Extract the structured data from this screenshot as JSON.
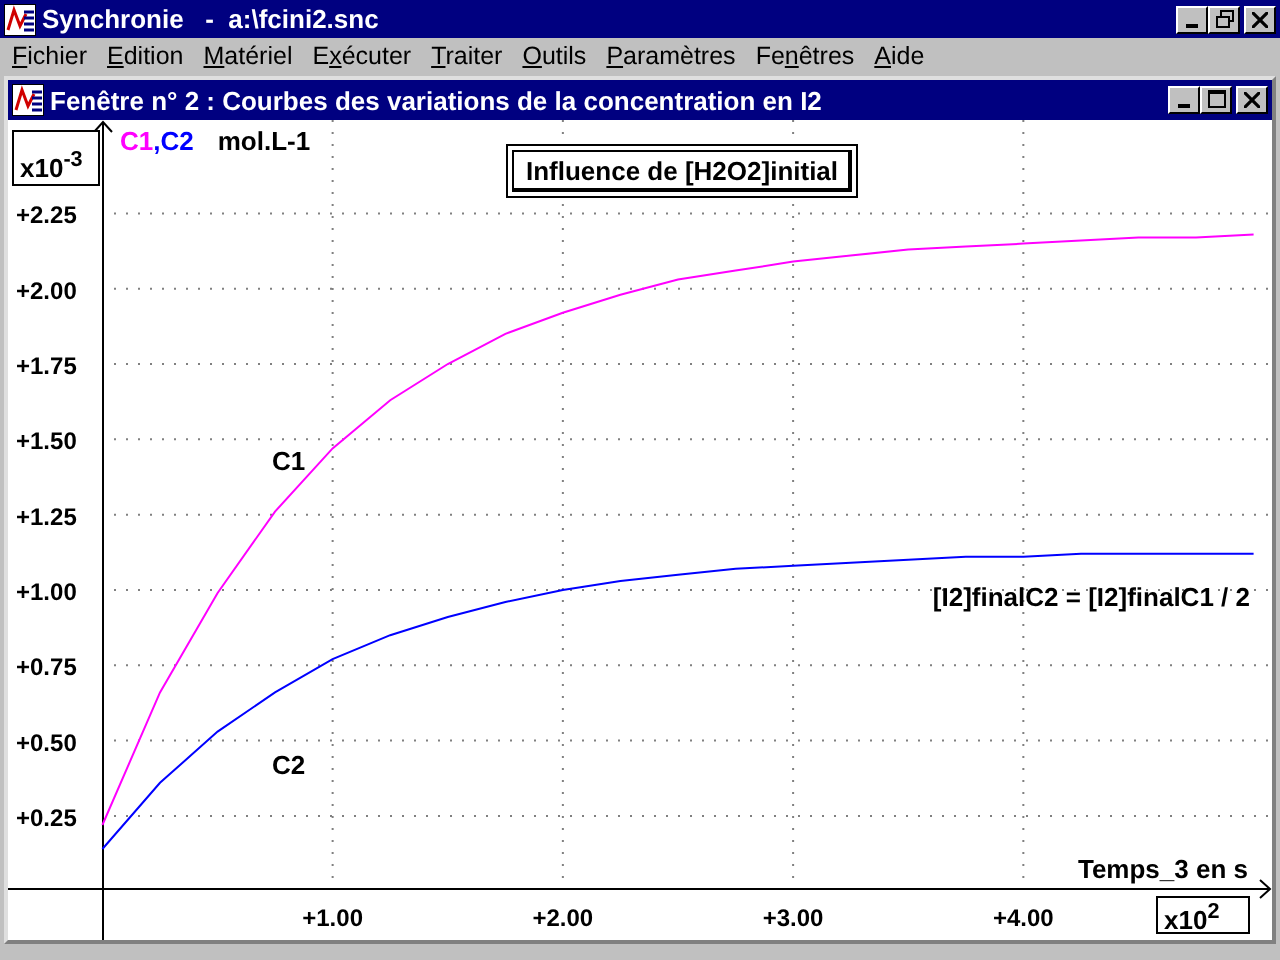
{
  "window": {
    "title": "Synchronie   -  a:\\fcini2.snc"
  },
  "menu": [
    {
      "key": "F",
      "after": "ichier"
    },
    {
      "key": "E",
      "after": "dition"
    },
    {
      "key": "M",
      "after": "atériel"
    },
    {
      "before": "E",
      "key": "x",
      "after": "écuter"
    },
    {
      "key": "T",
      "after": "raiter"
    },
    {
      "key": "O",
      "after": "utils"
    },
    {
      "key": "P",
      "after": "aramètres"
    },
    {
      "before": "Fe",
      "key": "n",
      "after": "êtres"
    },
    {
      "key": "A",
      "after": "ide"
    }
  ],
  "child_window": {
    "title": "Fenêtre n° 2 : Courbes des variations de la concentration en I2",
    "y_multiplier": "x10$^{-3}$",
    "x_multiplier": "x10$^{2}$",
    "legend_separator": ",",
    "chart_data": {
      "type": "line",
      "title": "Influence de [H2O2]initial",
      "xlabel": "Temps_3 en s",
      "ylabel": "mol.L-1",
      "grid": true,
      "x": [
        0,
        0.25,
        0.5,
        0.75,
        1,
        1.25,
        1.5,
        1.75,
        2,
        2.25,
        2.5,
        2.75,
        3,
        3.25,
        3.5,
        3.75,
        4,
        4.25,
        4.5,
        4.75,
        5
      ],
      "series": [
        {
          "name": "C1",
          "color": "#ff00ff",
          "values": [
            0.22,
            0.66,
            0.99,
            1.26,
            1.47,
            1.63,
            1.75,
            1.85,
            1.92,
            1.98,
            2.03,
            2.06,
            2.09,
            2.11,
            2.13,
            2.14,
            2.15,
            2.16,
            2.17,
            2.17,
            2.18
          ]
        },
        {
          "name": "C2",
          "color": "#0000ff",
          "values": [
            0.14,
            0.36,
            0.53,
            0.66,
            0.77,
            0.85,
            0.91,
            0.96,
            1.0,
            1.03,
            1.05,
            1.07,
            1.08,
            1.09,
            1.1,
            1.11,
            1.11,
            1.12,
            1.12,
            1.12,
            1.12
          ]
        }
      ],
      "xlim": [
        -0.41,
        5.08
      ],
      "ylim": [
        0,
        2.56
      ],
      "xticks": [
        {
          "value": 1,
          "label": "+1.00"
        },
        {
          "value": 2,
          "label": "+2.00"
        },
        {
          "value": 3,
          "label": "+3.00"
        },
        {
          "value": 4,
          "label": "+4.00"
        }
      ],
      "yticks": [
        {
          "value": 0.25,
          "label": "+0.25"
        },
        {
          "value": 0.5,
          "label": "+0.50"
        },
        {
          "value": 0.75,
          "label": "+0.75"
        },
        {
          "value": 1,
          "label": "+1.00"
        },
        {
          "value": 1.25,
          "label": "+1.25"
        },
        {
          "value": 1.5,
          "label": "+1.50"
        },
        {
          "value": 1.75,
          "label": "+1.75"
        },
        {
          "value": 2,
          "label": "+2.00"
        },
        {
          "value": 2.25,
          "label": "+2.25"
        }
      ],
      "annotations": [
        {
          "text": "C1"
        },
        {
          "text": "C2"
        },
        {
          "text": "[I2]finalC2 = [I2]finalC1 / 2"
        }
      ]
    }
  }
}
